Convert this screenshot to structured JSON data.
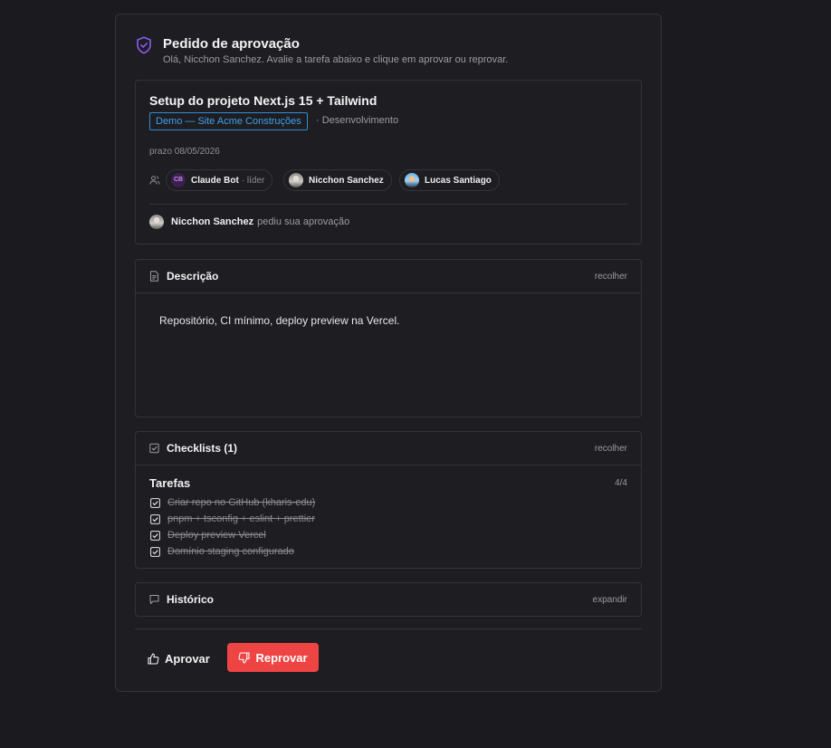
{
  "header": {
    "title": "Pedido de aprovação",
    "subtitle": "Olá, Nicchon Sanchez. Avalie a tarefa abaixo e clique em aprovar ou reprovar."
  },
  "task": {
    "title": "Setup do projeto Next.js 15 + Tailwind",
    "project": "Demo — Site Acme Construções",
    "category": "· Desenvolvimento",
    "due": "prazo 08/05/2026",
    "members": [
      {
        "avatar": "CB",
        "name": "Claude Bot",
        "role": "· líder"
      },
      {
        "name": "Nicchon Sanchez"
      },
      {
        "name": "Lucas Santiago"
      }
    ],
    "requester": {
      "name": "Nicchon Sanchez",
      "action": "pediu sua aprovação"
    }
  },
  "description": {
    "title": "Descrição",
    "toggle": "recolher",
    "text": "Repositório, CI mínimo, deploy preview na Vercel."
  },
  "checklists": {
    "title": "Checklists (1)",
    "toggle": "recolher",
    "list": {
      "title": "Tarefas",
      "count": "4/4",
      "items": [
        "Criar repo no GitHub (kharis-edu)",
        "pnpm + tsconfig + eslint + prettier",
        "Deploy preview Vercel",
        "Domínio staging configurado"
      ]
    }
  },
  "history": {
    "title": "Histórico",
    "toggle": "expandir"
  },
  "actions": {
    "approve": "Aprovar",
    "reject": "Reprovar"
  },
  "colors": {
    "accent": "#8b5cf6",
    "tag": "#3ea2ef",
    "reject": "#ef4444"
  }
}
